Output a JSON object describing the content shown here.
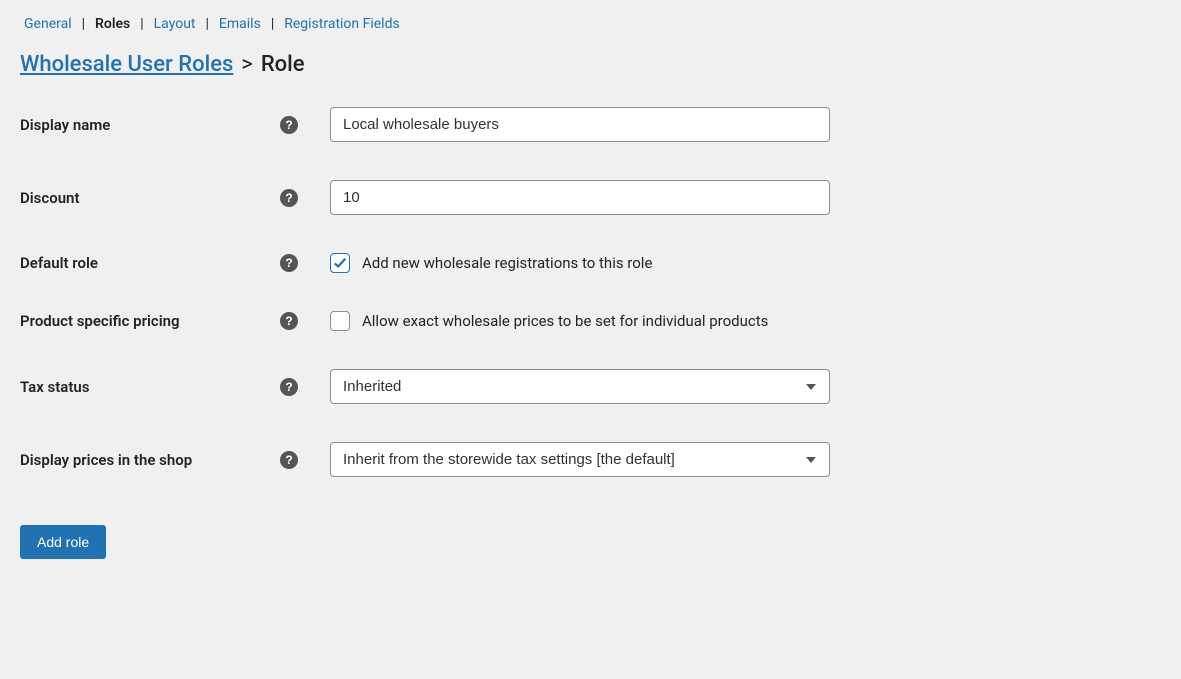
{
  "nav": {
    "tabs": [
      {
        "label": "General",
        "active": false
      },
      {
        "label": "Roles",
        "active": true
      },
      {
        "label": "Layout",
        "active": false
      },
      {
        "label": "Emails",
        "active": false
      },
      {
        "label": "Registration Fields",
        "active": false
      }
    ]
  },
  "breadcrumb": {
    "root": "Wholesale User Roles",
    "separator": ">",
    "current": "Role"
  },
  "form": {
    "display_name": {
      "label": "Display name",
      "value": "Local wholesale buyers"
    },
    "discount": {
      "label": "Discount",
      "value": "10"
    },
    "default_role": {
      "label": "Default role",
      "checkbox_label": "Add new wholesale registrations to this role",
      "checked": true
    },
    "product_pricing": {
      "label": "Product specific pricing",
      "checkbox_label": "Allow exact wholesale prices to be set for individual products",
      "checked": false
    },
    "tax_status": {
      "label": "Tax status",
      "selected": "Inherited"
    },
    "display_prices": {
      "label": "Display prices in the shop",
      "selected": "Inherit from the storewide tax settings [the default]"
    }
  },
  "actions": {
    "submit": "Add role"
  }
}
